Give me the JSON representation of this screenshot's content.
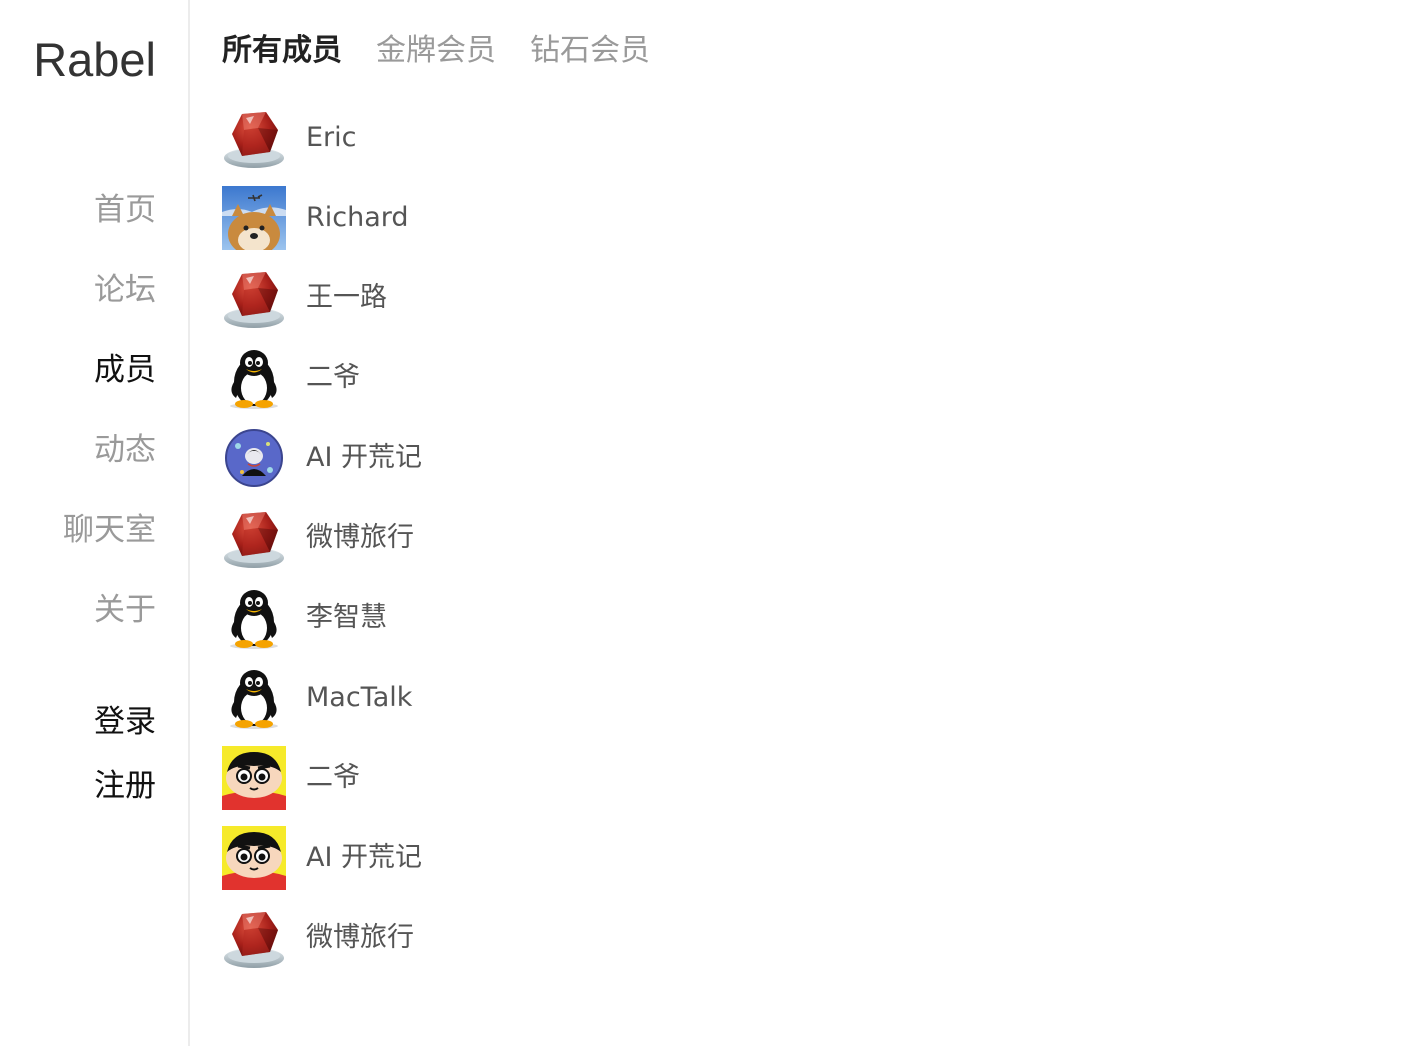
{
  "brand": "Rabel",
  "sidebar": {
    "nav": [
      {
        "label": "首页",
        "active": false
      },
      {
        "label": "论坛",
        "active": false
      },
      {
        "label": "成员",
        "active": true
      },
      {
        "label": "动态",
        "active": false
      },
      {
        "label": "聊天室",
        "active": false
      },
      {
        "label": "关于",
        "active": false
      }
    ],
    "auth": {
      "login": "登录",
      "register": "注册"
    }
  },
  "tabs": [
    {
      "label": "所有成员",
      "active": true
    },
    {
      "label": "金牌会员",
      "active": false
    },
    {
      "label": "钻石会员",
      "active": false
    }
  ],
  "members": [
    {
      "name": "Eric",
      "avatar": "ruby-gem-icon"
    },
    {
      "name": "Richard",
      "avatar": "shiba-dog-photo"
    },
    {
      "name": "王一路",
      "avatar": "ruby-gem-icon"
    },
    {
      "name": "二爷",
      "avatar": "penguin-icon"
    },
    {
      "name": "AI 开荒记",
      "avatar": "circle-photo"
    },
    {
      "name": "微博旅行",
      "avatar": "ruby-gem-icon"
    },
    {
      "name": "李智慧",
      "avatar": "penguin-icon"
    },
    {
      "name": "MacTalk",
      "avatar": "penguin-icon"
    },
    {
      "name": "二爷",
      "avatar": "cartoon-boy-icon"
    },
    {
      "name": "AI 开荒记",
      "avatar": "cartoon-boy-icon"
    },
    {
      "name": "微博旅行",
      "avatar": "ruby-gem-icon"
    }
  ]
}
